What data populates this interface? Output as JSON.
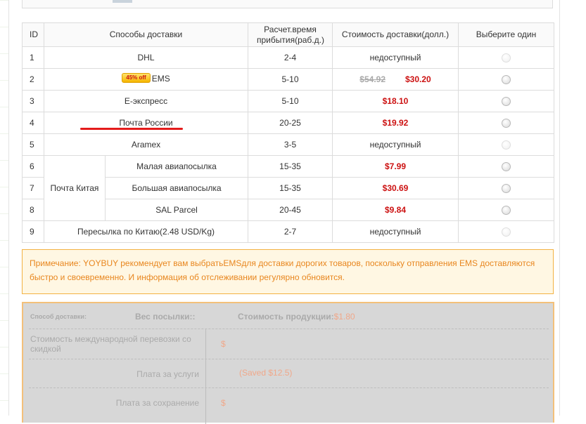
{
  "table": {
    "headers": {
      "id": "ID",
      "method": "Способы доставки",
      "time": "Расчет.время прибытия(раб.д.)",
      "cost": "Стоимость доставки(долл.)",
      "select": "Выберите один"
    },
    "rows": [
      {
        "id": "1",
        "method": "DHL",
        "time": "2-4",
        "cost": "недоступный"
      },
      {
        "id": "2",
        "method": "EMS",
        "badge": "45% off",
        "time": "5-10",
        "old_price": "$54.92",
        "price": "$30.20"
      },
      {
        "id": "3",
        "method": "E-экспресс",
        "time": "5-10",
        "price": "$18.10"
      },
      {
        "id": "4",
        "method": "Почта России",
        "time": "20-25",
        "price": "$19.92"
      },
      {
        "id": "5",
        "method": "Aramex",
        "time": "3-5",
        "cost": "недоступный"
      },
      {
        "id": "6",
        "group": "Почта Китая",
        "method": "Малая авиапосылка",
        "time": "15-35",
        "price": "$7.99"
      },
      {
        "id": "7",
        "method": "Большая авиапосылка",
        "time": "15-35",
        "price": "$30.69"
      },
      {
        "id": "8",
        "method": "SAL Parcel",
        "time": "20-45",
        "price": "$9.84"
      },
      {
        "id": "9",
        "method": "Пересылка по Китаю(2.48 USD/Kg)",
        "time": "2-7",
        "cost": "недоступный"
      }
    ]
  },
  "note": {
    "text": "Примечание: YOYBUY рекомендует вам выбратьEMSдля доставки дорогих товаров, поскольку отправления EMS доставляются быстро и своевременно. И информация об отслеживании регулярно обновится."
  },
  "summary": {
    "method_label": "Способ доставки:",
    "weight_label": "Вес посылки::",
    "product_cost_label": "Стоимость продукции:",
    "product_cost_value": "$1.80",
    "intl_label": "Стоимость международной перевозки со скидкой",
    "intl_value": "$",
    "service_label": "Плата за услуги",
    "service_value": "(Saved $12.5)",
    "storage_label": "Плата за сохранение",
    "storage_value": "$"
  },
  "colors": {
    "price_red": "#cc1111",
    "note_border": "#f3b243",
    "note_text": "#e8861e",
    "highlight_underline": "#e41b1b"
  }
}
